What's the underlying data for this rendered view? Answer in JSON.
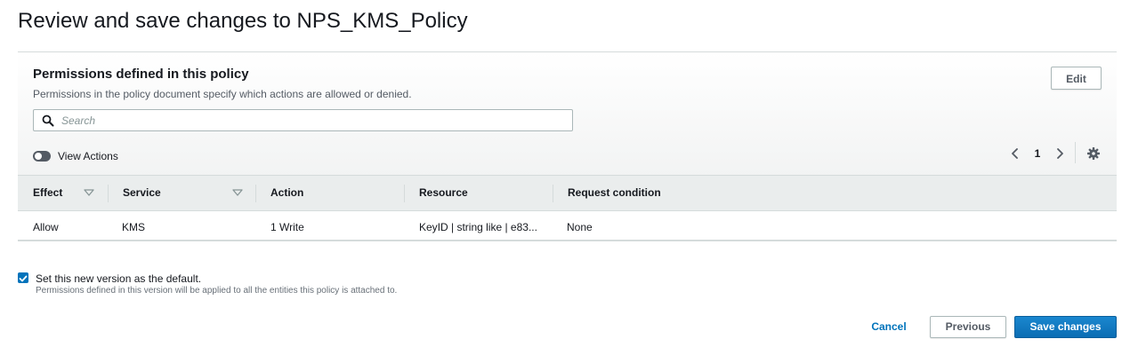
{
  "page": {
    "title": "Review and save changes to NPS_KMS_Policy"
  },
  "permissions_panel": {
    "title": "Permissions defined in this policy",
    "description": "Permissions in the policy document specify which actions are allowed or denied.",
    "edit_label": "Edit",
    "search": {
      "placeholder": "Search",
      "value": "",
      "icon": "search-icon"
    },
    "view_actions": {
      "label": "View Actions",
      "enabled": false
    },
    "pagination": {
      "current_page": "1"
    },
    "table": {
      "columns": [
        "Effect",
        "Service",
        "Action",
        "Resource",
        "Request condition"
      ],
      "rows": [
        {
          "effect": "Allow",
          "service": "KMS",
          "action": "1 Write",
          "resource": "KeyID | string like | e83...",
          "request_condition": "None"
        }
      ]
    }
  },
  "default_version": {
    "checked": true,
    "label": "Set this new version as the default.",
    "hint": "Permissions defined in this version will be applied to all the entities this policy is attached to."
  },
  "footer": {
    "cancel_label": "Cancel",
    "previous_label": "Previous",
    "save_label": "Save changes"
  },
  "colors": {
    "primary": "#0073bb",
    "header_bg": "#eaeded",
    "panel_bg": "#f2f3f3",
    "border": "#d5dbdb"
  }
}
